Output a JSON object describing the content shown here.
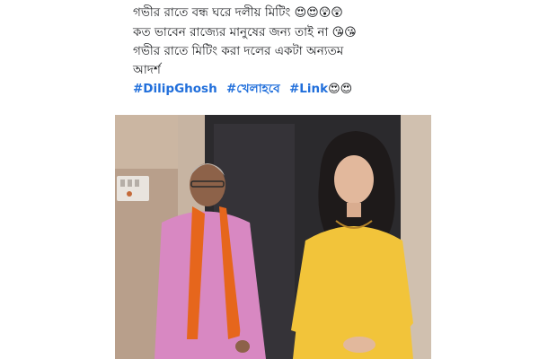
{
  "post": {
    "lines": [
      {
        "text": "গভীর রাতে বন্ধ ঘরে দলীয় মিটিং",
        "emoji": "😍😍😲😲"
      },
      {
        "text": "কত ভাবেন রাজ্যের মানুষের জন্য তাই না",
        "emoji": "😘😘"
      },
      {
        "text": "গভীর রাতে মিটিং করা দলের একটা অন্যতম",
        "emoji": ""
      },
      {
        "text": "আদর্শ",
        "emoji": ""
      }
    ],
    "hashtags": [
      "#DilipGhosh",
      "#খেলাহবে",
      "#Link"
    ],
    "hashtag_emoji": "😍😍",
    "link_color": "#216fdb"
  },
  "icons": {
    "emoji_heart_eyes": "smiling-face-with-heart-eyes",
    "emoji_astonished": "astonished-face",
    "emoji_kiss": "face-blowing-a-kiss"
  }
}
